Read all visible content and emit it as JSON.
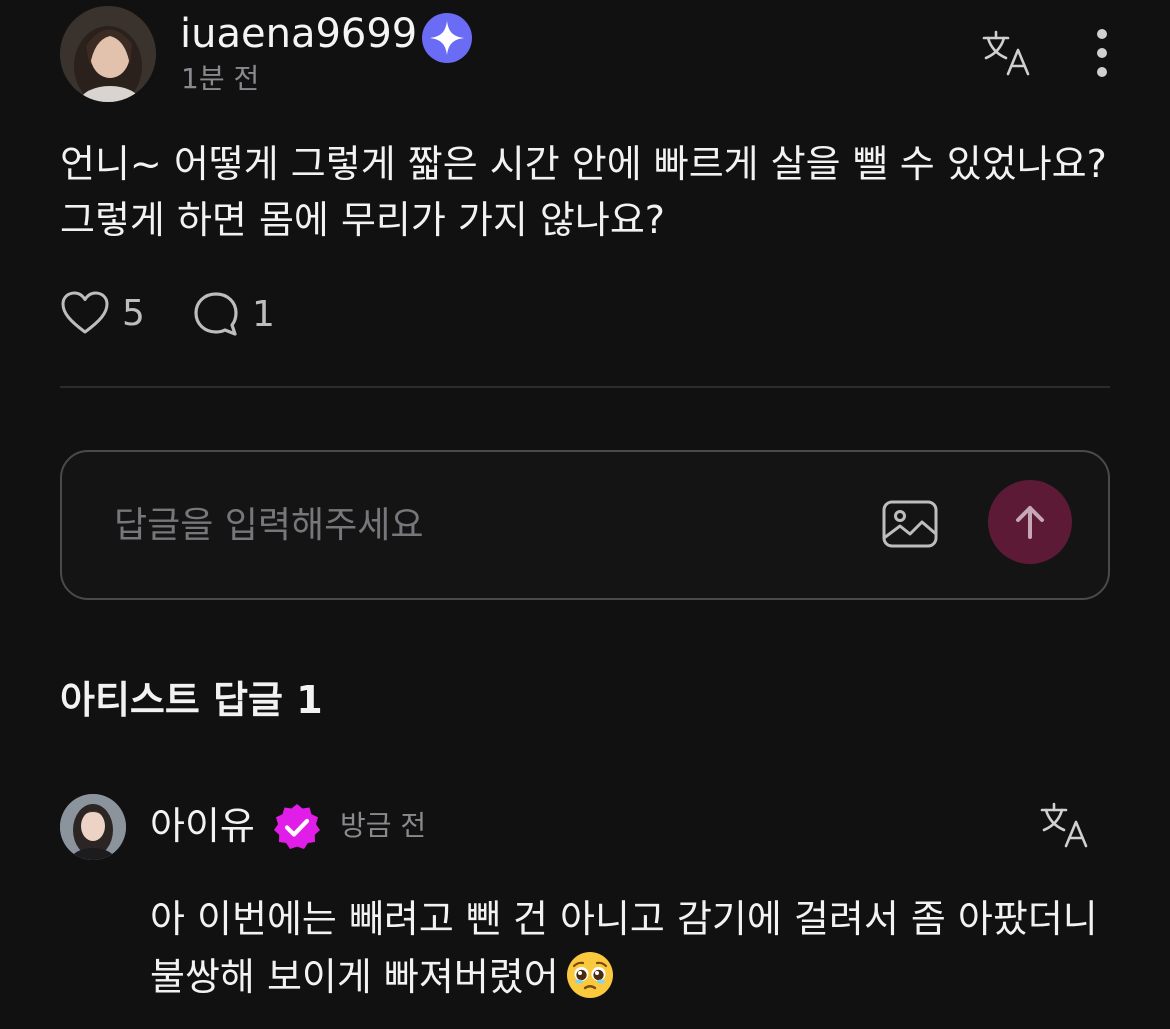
{
  "post": {
    "username": "iuaena9699",
    "time": "1분 전",
    "body": "언니~ 어떻게 그렇게 짧은 시간 안에 빠르게 살을 뺄 수 있었나요? 그렇게 하면 몸에 무리가 가지 않나요?",
    "like_count": "5",
    "comment_count": "1"
  },
  "reply_input": {
    "placeholder": "답글을 입력해주세요"
  },
  "artist_replies": {
    "title": "아티스트 답글 1",
    "items": [
      {
        "username": "아이유",
        "time": "방금 전",
        "body": "아 이번에는 빼려고 뺀 건 아니고 감기에 걸려서 좀 아팠더니 불쌍해 보이게 빠져버렸어",
        "emoji": "pleading-face"
      }
    ]
  },
  "colors": {
    "background": "#111112",
    "verified_blue": "#6b6cf5",
    "verified_pink": "#e01ee8",
    "send_button": "#5d1a37",
    "muted_text": "#8a8a8e"
  },
  "icons": {
    "post_badge": "verified-sparkle-icon",
    "translate": "translate-icon",
    "more": "more-vertical-icon",
    "like": "heart-icon",
    "comment": "comment-bubble-icon",
    "image": "image-icon",
    "send": "arrow-up-icon",
    "artist_badge": "verified-check-icon"
  }
}
